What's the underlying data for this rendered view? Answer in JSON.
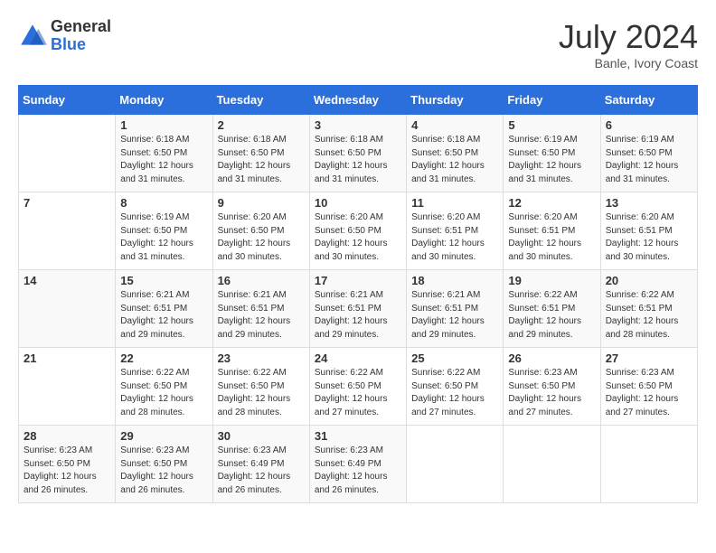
{
  "header": {
    "logo_general": "General",
    "logo_blue": "Blue",
    "title": "July 2024",
    "location": "Banle, Ivory Coast"
  },
  "weekdays": [
    "Sunday",
    "Monday",
    "Tuesday",
    "Wednesday",
    "Thursday",
    "Friday",
    "Saturday"
  ],
  "weeks": [
    [
      {
        "day": "",
        "info": ""
      },
      {
        "day": "1",
        "info": "Sunrise: 6:18 AM\nSunset: 6:50 PM\nDaylight: 12 hours and 31 minutes."
      },
      {
        "day": "2",
        "info": "Sunrise: 6:18 AM\nSunset: 6:50 PM\nDaylight: 12 hours and 31 minutes."
      },
      {
        "day": "3",
        "info": "Sunrise: 6:18 AM\nSunset: 6:50 PM\nDaylight: 12 hours and 31 minutes."
      },
      {
        "day": "4",
        "info": "Sunrise: 6:18 AM\nSunset: 6:50 PM\nDaylight: 12 hours and 31 minutes."
      },
      {
        "day": "5",
        "info": "Sunrise: 6:19 AM\nSunset: 6:50 PM\nDaylight: 12 hours and 31 minutes."
      },
      {
        "day": "6",
        "info": "Sunrise: 6:19 AM\nSunset: 6:50 PM\nDaylight: 12 hours and 31 minutes."
      }
    ],
    [
      {
        "day": "7",
        "info": ""
      },
      {
        "day": "8",
        "info": "Sunrise: 6:19 AM\nSunset: 6:50 PM\nDaylight: 12 hours and 31 minutes."
      },
      {
        "day": "9",
        "info": "Sunrise: 6:20 AM\nSunset: 6:50 PM\nDaylight: 12 hours and 30 minutes."
      },
      {
        "day": "10",
        "info": "Sunrise: 6:20 AM\nSunset: 6:50 PM\nDaylight: 12 hours and 30 minutes."
      },
      {
        "day": "11",
        "info": "Sunrise: 6:20 AM\nSunset: 6:51 PM\nDaylight: 12 hours and 30 minutes."
      },
      {
        "day": "12",
        "info": "Sunrise: 6:20 AM\nSunset: 6:51 PM\nDaylight: 12 hours and 30 minutes."
      },
      {
        "day": "13",
        "info": "Sunrise: 6:20 AM\nSunset: 6:51 PM\nDaylight: 12 hours and 30 minutes."
      }
    ],
    [
      {
        "day": "14",
        "info": ""
      },
      {
        "day": "15",
        "info": "Sunrise: 6:21 AM\nSunset: 6:51 PM\nDaylight: 12 hours and 29 minutes."
      },
      {
        "day": "16",
        "info": "Sunrise: 6:21 AM\nSunset: 6:51 PM\nDaylight: 12 hours and 29 minutes."
      },
      {
        "day": "17",
        "info": "Sunrise: 6:21 AM\nSunset: 6:51 PM\nDaylight: 12 hours and 29 minutes."
      },
      {
        "day": "18",
        "info": "Sunrise: 6:21 AM\nSunset: 6:51 PM\nDaylight: 12 hours and 29 minutes."
      },
      {
        "day": "19",
        "info": "Sunrise: 6:22 AM\nSunset: 6:51 PM\nDaylight: 12 hours and 29 minutes."
      },
      {
        "day": "20",
        "info": "Sunrise: 6:22 AM\nSunset: 6:51 PM\nDaylight: 12 hours and 28 minutes."
      }
    ],
    [
      {
        "day": "21",
        "info": ""
      },
      {
        "day": "22",
        "info": "Sunrise: 6:22 AM\nSunset: 6:50 PM\nDaylight: 12 hours and 28 minutes."
      },
      {
        "day": "23",
        "info": "Sunrise: 6:22 AM\nSunset: 6:50 PM\nDaylight: 12 hours and 28 minutes."
      },
      {
        "day": "24",
        "info": "Sunrise: 6:22 AM\nSunset: 6:50 PM\nDaylight: 12 hours and 27 minutes."
      },
      {
        "day": "25",
        "info": "Sunrise: 6:22 AM\nSunset: 6:50 PM\nDaylight: 12 hours and 27 minutes."
      },
      {
        "day": "26",
        "info": "Sunrise: 6:23 AM\nSunset: 6:50 PM\nDaylight: 12 hours and 27 minutes."
      },
      {
        "day": "27",
        "info": "Sunrise: 6:23 AM\nSunset: 6:50 PM\nDaylight: 12 hours and 27 minutes."
      }
    ],
    [
      {
        "day": "28",
        "info": "Sunrise: 6:23 AM\nSunset: 6:50 PM\nDaylight: 12 hours and 26 minutes."
      },
      {
        "day": "29",
        "info": "Sunrise: 6:23 AM\nSunset: 6:50 PM\nDaylight: 12 hours and 26 minutes."
      },
      {
        "day": "30",
        "info": "Sunrise: 6:23 AM\nSunset: 6:49 PM\nDaylight: 12 hours and 26 minutes."
      },
      {
        "day": "31",
        "info": "Sunrise: 6:23 AM\nSunset: 6:49 PM\nDaylight: 12 hours and 26 minutes."
      },
      {
        "day": "",
        "info": ""
      },
      {
        "day": "",
        "info": ""
      },
      {
        "day": "",
        "info": ""
      }
    ]
  ]
}
